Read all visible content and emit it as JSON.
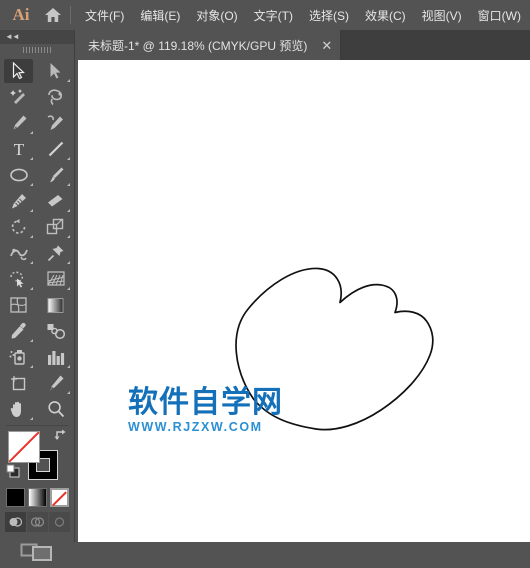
{
  "app": {
    "name": "Ai",
    "logo_color": "#d9a077",
    "chrome_color": "#535353"
  },
  "menubar": {
    "home_icon": "home-icon",
    "items": [
      {
        "label": "文件(F)"
      },
      {
        "label": "编辑(E)"
      },
      {
        "label": "对象(O)"
      },
      {
        "label": "文字(T)"
      },
      {
        "label": "选择(S)"
      },
      {
        "label": "效果(C)"
      },
      {
        "label": "视图(V)"
      },
      {
        "label": "窗口(W)"
      }
    ]
  },
  "tabbar": {
    "tabs": [
      {
        "title": "未标题-1* @ 119.18% (CMYK/GPU 预览)",
        "close_label": "✕",
        "active": true
      }
    ]
  },
  "toolpanel": {
    "collapse_label": "◄◄",
    "tools": [
      {
        "name": "selection-tool",
        "active": true,
        "corner": false
      },
      {
        "name": "direct-selection-tool",
        "active": false,
        "corner": true
      },
      {
        "name": "magic-wand-tool",
        "active": false,
        "corner": false
      },
      {
        "name": "lasso-tool",
        "active": false,
        "corner": false
      },
      {
        "name": "pen-tool",
        "active": false,
        "corner": true
      },
      {
        "name": "curvature-tool",
        "active": false,
        "corner": false
      },
      {
        "name": "type-tool",
        "active": false,
        "corner": true
      },
      {
        "name": "line-segment-tool",
        "active": false,
        "corner": true
      },
      {
        "name": "ellipse-tool",
        "active": false,
        "corner": true
      },
      {
        "name": "paintbrush-tool",
        "active": false,
        "corner": true
      },
      {
        "name": "blob-brush-tool",
        "active": false,
        "corner": true
      },
      {
        "name": "eraser-tool",
        "active": false,
        "corner": true
      },
      {
        "name": "rotate-tool",
        "active": false,
        "corner": true
      },
      {
        "name": "scale-tool",
        "active": false,
        "corner": true
      },
      {
        "name": "width-warp-tool",
        "active": false,
        "corner": true
      },
      {
        "name": "puppet-warp-tool",
        "active": false,
        "corner": true
      },
      {
        "name": "shape-builder-tool",
        "active": false,
        "corner": true
      },
      {
        "name": "perspective-grid-tool",
        "active": false,
        "corner": true
      },
      {
        "name": "mesh-tool",
        "active": false,
        "corner": false
      },
      {
        "name": "gradient-tool",
        "active": false,
        "corner": false
      },
      {
        "name": "eyedropper-tool",
        "active": false,
        "corner": true
      },
      {
        "name": "blend-tool",
        "active": false,
        "corner": false
      },
      {
        "name": "symbol-sprayer-tool",
        "active": false,
        "corner": true
      },
      {
        "name": "column-graph-tool",
        "active": false,
        "corner": true
      },
      {
        "name": "artboard-tool",
        "active": false,
        "corner": false
      },
      {
        "name": "slice-tool",
        "active": false,
        "corner": true
      },
      {
        "name": "hand-tool",
        "active": false,
        "corner": true
      },
      {
        "name": "zoom-tool",
        "active": false,
        "corner": false
      }
    ],
    "fill_stroke": {
      "fill_name": "fill-swatch",
      "fill_value": "none",
      "stroke_name": "stroke-swatch",
      "stroke_value": "#000000",
      "swap_name": "swap-fill-stroke-icon",
      "default_name": "default-fill-stroke-icon"
    },
    "color_modes": [
      {
        "name": "color-button",
        "selected": false
      },
      {
        "name": "gradient-button",
        "selected": false
      },
      {
        "name": "none-button",
        "selected": true
      }
    ],
    "draw_modes": [
      {
        "name": "draw-normal-button",
        "selected": true
      },
      {
        "name": "draw-behind-button",
        "selected": false
      },
      {
        "name": "draw-inside-button",
        "selected": false
      }
    ],
    "screen_mode": {
      "name": "change-screen-mode-button"
    }
  },
  "canvas": {
    "background": "#ffffff",
    "artwork": {
      "name": "hand-drawn-cloud-path",
      "stroke_color": "#000000",
      "fill": "none",
      "stroke_width": 1.6
    },
    "watermark": {
      "chinese": "软件自学网",
      "english": "WWW.RJZXW.COM",
      "chinese_color": "#1470b8",
      "english_color": "#2b8fd4"
    }
  }
}
